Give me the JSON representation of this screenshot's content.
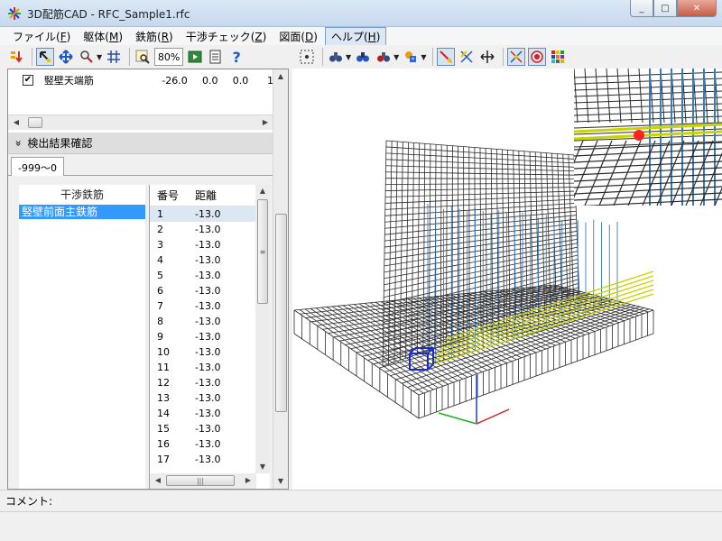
{
  "window": {
    "title": "3D配筋CAD - RFC_Sample1.rfc",
    "minimize": "_",
    "maximize": "□",
    "close": "✕"
  },
  "menu": [
    {
      "label": "ファイル(",
      "key": "F",
      "suffix": ")"
    },
    {
      "label": "躯体(",
      "key": "M",
      "suffix": ")"
    },
    {
      "label": "鉄筋(",
      "key": "R",
      "suffix": ")"
    },
    {
      "label": "干渉チェック(",
      "key": "Z",
      "suffix": ")"
    },
    {
      "label": "図面(",
      "key": "D",
      "suffix": ")"
    },
    {
      "label": "ヘルプ(",
      "key": "H",
      "suffix": ")"
    }
  ],
  "toolbar": {
    "zoom": "80%",
    "help_glyph": "?"
  },
  "property_row": {
    "checked": true,
    "check_glyph": "✔",
    "name": "竪壁天端筋",
    "v1": "-26.0",
    "v2": "0.0",
    "v3": "0.0",
    "v4": "1"
  },
  "detection": {
    "header": "検出結果確認",
    "collapse_glyph": "»",
    "tab": "-999～0",
    "list_header": "干渉鉄筋",
    "list_items": [
      "竪壁前面主鉄筋"
    ],
    "grid_headers": [
      "番号",
      "距離"
    ],
    "rows": [
      {
        "no": "1",
        "dist": "-13.0"
      },
      {
        "no": "2",
        "dist": "-13.0"
      },
      {
        "no": "3",
        "dist": "-13.0"
      },
      {
        "no": "4",
        "dist": "-13.0"
      },
      {
        "no": "5",
        "dist": "-13.0"
      },
      {
        "no": "6",
        "dist": "-13.0"
      },
      {
        "no": "7",
        "dist": "-13.0"
      },
      {
        "no": "8",
        "dist": "-13.0"
      },
      {
        "no": "9",
        "dist": "-13.0"
      },
      {
        "no": "10",
        "dist": "-13.0"
      },
      {
        "no": "11",
        "dist": "-13.0"
      },
      {
        "no": "12",
        "dist": "-13.0"
      },
      {
        "no": "13",
        "dist": "-13.0"
      },
      {
        "no": "14",
        "dist": "-13.0"
      },
      {
        "no": "15",
        "dist": "-13.0"
      },
      {
        "no": "16",
        "dist": "-13.0"
      },
      {
        "no": "17",
        "dist": "-13.0"
      }
    ]
  },
  "status": {
    "comment_label": "コメント:"
  },
  "colors": {
    "rebar_dark": "#2a2a2a",
    "rebar_blue": "#3a7bbf",
    "rebar_yellow": "#c8d400",
    "selection": "#3399ff",
    "cursor_box": "#1a2ad8",
    "interference_point": "#ff2020"
  }
}
